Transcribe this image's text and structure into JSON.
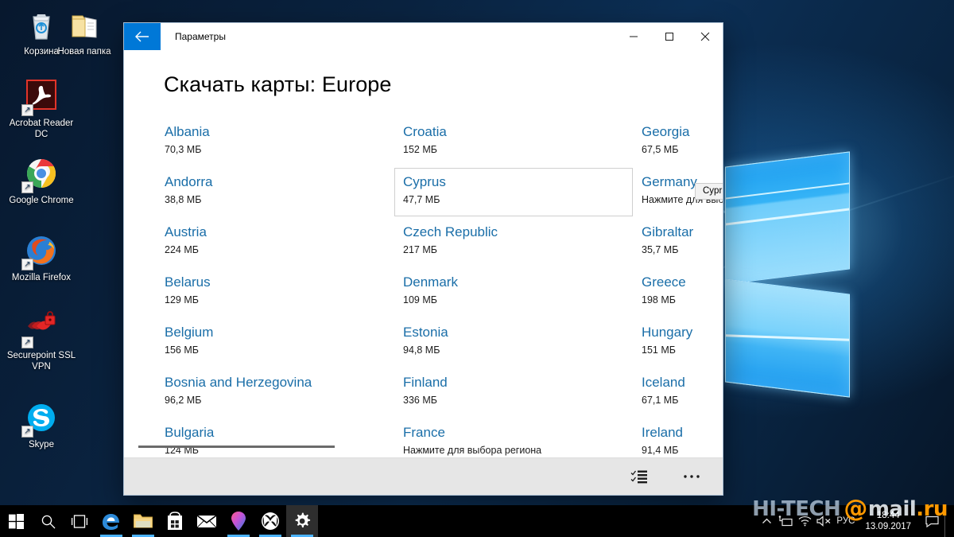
{
  "desktop": {
    "icons": [
      {
        "name": "Корзина",
        "icon": "recycle-bin-icon",
        "shortcut": false
      },
      {
        "name": "Новая папка",
        "icon": "folder-icon",
        "shortcut": false
      },
      {
        "name": "Acrobat Reader DC",
        "icon": "acrobat-reader-icon",
        "shortcut": true
      },
      {
        "name": "Google Chrome",
        "icon": "chrome-icon",
        "shortcut": true
      },
      {
        "name": "Mozilla Firefox",
        "icon": "firefox-icon",
        "shortcut": true
      },
      {
        "name": "Securepoint SSL VPN",
        "icon": "securepoint-vpn-icon",
        "shortcut": true
      },
      {
        "name": "Skype",
        "icon": "skype-icon",
        "shortcut": true
      }
    ]
  },
  "window": {
    "title": "Параметры",
    "back_label": "←",
    "controls": {
      "minimize": "─",
      "maximize": "▢",
      "close": "✕"
    },
    "page_title": "Скачать карты: Europe"
  },
  "maps": {
    "columns": [
      {
        "items": [
          {
            "name": "Albania",
            "size": "70,3 МБ",
            "hover": false
          },
          {
            "name": "Andorra",
            "size": "38,8 МБ",
            "hover": false
          },
          {
            "name": "Austria",
            "size": "224 МБ",
            "hover": false
          },
          {
            "name": "Belarus",
            "size": "129 МБ",
            "hover": false
          },
          {
            "name": "Belgium",
            "size": "156 МБ",
            "hover": false
          },
          {
            "name": "Bosnia and Herzegovina",
            "size": "96,2 МБ",
            "hover": false
          },
          {
            "name": "Bulgaria",
            "size": "124 МБ",
            "hover": false
          }
        ]
      },
      {
        "items": [
          {
            "name": "Croatia",
            "size": "152 МБ",
            "hover": false
          },
          {
            "name": "Cyprus",
            "size": "47,7 МБ",
            "hover": true
          },
          {
            "name": "Czech Republic",
            "size": "217 МБ",
            "hover": false
          },
          {
            "name": "Denmark",
            "size": "109 МБ",
            "hover": false
          },
          {
            "name": "Estonia",
            "size": "94,8 МБ",
            "hover": false
          },
          {
            "name": "Finland",
            "size": "336 МБ",
            "hover": false
          },
          {
            "name": "France",
            "size": "Нажмите для выбора региона",
            "hover": false
          }
        ]
      },
      {
        "items": [
          {
            "name": "Georgia",
            "size": "67,5 МБ",
            "hover": false
          },
          {
            "name": "Germany",
            "size": "Нажмите для выбора региона",
            "hover": false
          },
          {
            "name": "Gibraltar",
            "size": "35,7 МБ",
            "hover": false
          },
          {
            "name": "Greece",
            "size": "198 МБ",
            "hover": false
          },
          {
            "name": "Hungary",
            "size": "151 МБ",
            "hover": false
          },
          {
            "name": "Iceland",
            "size": "67,1 МБ",
            "hover": false
          },
          {
            "name": "Ireland",
            "size": "91,4 МБ",
            "hover": false
          }
        ]
      }
    ],
    "tooltip": "Cyprus"
  },
  "appbar": {
    "select_label": "Выбрать",
    "more_label": "···"
  },
  "taskbar": {
    "buttons": [
      {
        "icon": "windows-start-icon",
        "label": "Пуск",
        "active": false,
        "running": false
      },
      {
        "icon": "search-icon",
        "label": "Поиск",
        "active": false,
        "running": false
      },
      {
        "icon": "task-view-icon",
        "label": "Представление задач",
        "active": false,
        "running": false
      },
      {
        "icon": "edge-icon",
        "label": "Microsoft Edge",
        "active": false,
        "running": true
      },
      {
        "icon": "file-explorer-icon",
        "label": "Проводник",
        "active": false,
        "running": true
      },
      {
        "icon": "microsoft-store-icon",
        "label": "Магазин",
        "active": false,
        "running": false
      },
      {
        "icon": "mail-icon",
        "label": "Почта",
        "active": false,
        "running": false
      },
      {
        "icon": "maps-pin-icon",
        "label": "Карты",
        "active": false,
        "running": true
      },
      {
        "icon": "xbox-icon",
        "label": "Xbox",
        "active": false,
        "running": true
      },
      {
        "icon": "settings-gear-icon",
        "label": "Параметры",
        "active": true,
        "running": true
      }
    ],
    "tray": {
      "items": [
        {
          "icon": "chevron-up-icon",
          "label": "Отображать скрытые значки"
        },
        {
          "icon": "network-device-icon",
          "label": "Сеть"
        },
        {
          "icon": "wifi-icon",
          "label": "Беспроводная сеть"
        },
        {
          "icon": "speaker-muted-icon",
          "label": "Звук выключен"
        }
      ],
      "language": "РУС",
      "time": "18:44",
      "date": "13.09.2017",
      "action_center": "notification-icon"
    }
  },
  "watermark": {
    "part1": "HI-TECH",
    "at": "@",
    "part2": "mail",
    "part3": ".ru"
  },
  "colors": {
    "accent": "#0078d7",
    "link": "#1a6ea8",
    "appbar_bg": "#e6e6e6",
    "tooltip_bg": "#f2f2f2",
    "taskbar_bg": "#000000",
    "desktop_bg": "#0a2340",
    "watermark_orange": "#ff9900"
  }
}
